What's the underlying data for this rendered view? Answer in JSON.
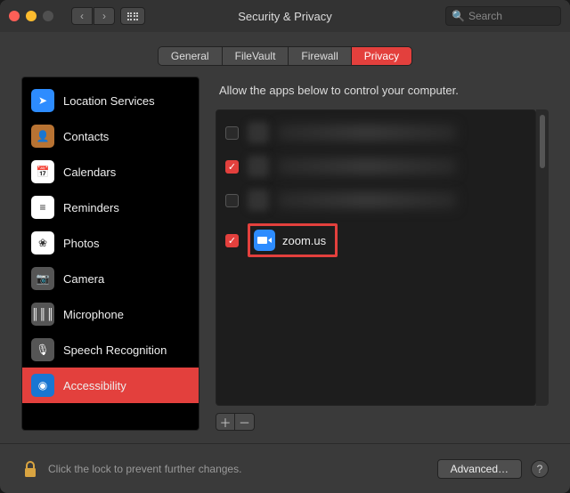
{
  "window": {
    "title": "Security & Privacy"
  },
  "search": {
    "placeholder": "Search"
  },
  "tabs": [
    {
      "label": "General",
      "active": false
    },
    {
      "label": "FileVault",
      "active": false
    },
    {
      "label": "Firewall",
      "active": false
    },
    {
      "label": "Privacy",
      "active": true
    }
  ],
  "sidebar": {
    "items": [
      {
        "label": "Location Services",
        "name": "location-services",
        "icon": "location-arrow-icon",
        "bg": "#2d8cff",
        "glyph": "➤"
      },
      {
        "label": "Contacts",
        "name": "contacts",
        "icon": "contacts-icon",
        "bg": "#b87333",
        "glyph": "👤"
      },
      {
        "label": "Calendars",
        "name": "calendars",
        "icon": "calendar-icon",
        "bg": "#fff",
        "glyph": "📅"
      },
      {
        "label": "Reminders",
        "name": "reminders",
        "icon": "reminders-icon",
        "bg": "#fff",
        "glyph": "≡"
      },
      {
        "label": "Photos",
        "name": "photos",
        "icon": "photos-icon",
        "bg": "#fff",
        "glyph": "❀"
      },
      {
        "label": "Camera",
        "name": "camera",
        "icon": "camera-icon",
        "bg": "#555",
        "glyph": "📷"
      },
      {
        "label": "Microphone",
        "name": "microphone",
        "icon": "microphone-icon",
        "bg": "#555",
        "glyph": "║║║"
      },
      {
        "label": "Speech Recognition",
        "name": "speech-recognition",
        "icon": "speech-icon",
        "bg": "#555",
        "glyph": "🎙"
      },
      {
        "label": "Accessibility",
        "name": "accessibility",
        "icon": "accessibility-icon",
        "bg": "#1976d2",
        "glyph": "◉",
        "selected": true
      }
    ]
  },
  "main": {
    "description": "Allow the apps below to control your computer.",
    "apps": [
      {
        "checked": false,
        "redacted": true
      },
      {
        "checked": true,
        "redacted": true
      },
      {
        "checked": false,
        "redacted": true
      },
      {
        "checked": true,
        "redacted": false,
        "name": "zoom.us",
        "highlighted": true,
        "icon": "zoom-icon"
      }
    ]
  },
  "footer": {
    "lock_text": "Click the lock to prevent further changes.",
    "advanced_label": "Advanced…"
  }
}
